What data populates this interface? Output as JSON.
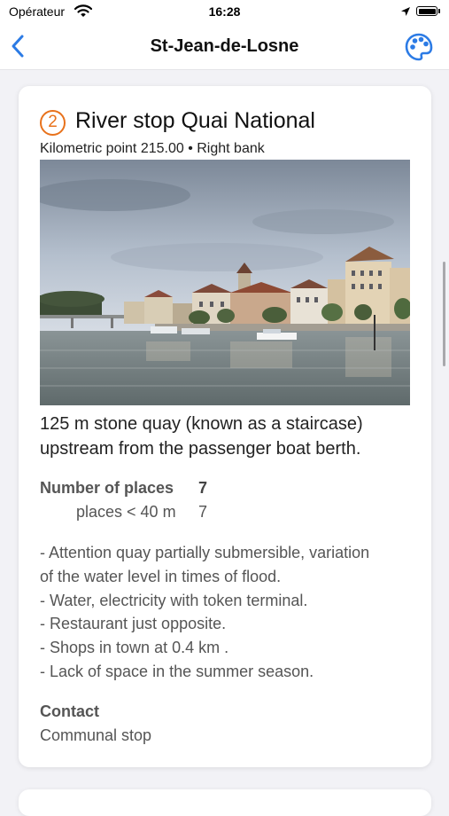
{
  "status_bar": {
    "carrier": "Opérateur",
    "time": "16:28"
  },
  "nav": {
    "title": "St-Jean-de-Losne",
    "back_icon": "chevron-left-icon",
    "palette_icon": "palette-icon",
    "accent_color": "#2c7be5"
  },
  "stop": {
    "number": "2",
    "title": "River stop Quai National",
    "subtitle": "Kilometric point 215.00 • Right bank",
    "badge_color": "#e8721c",
    "description": "125 m stone quay (known as a staircase) upstream from the passenger boat berth.",
    "places": {
      "label": "Number of places",
      "value": "7",
      "sub_label": "places < 40 m",
      "sub_value": "7"
    },
    "notes": [
      "- Attention quay partially submersible, variation",
      "of the water level in times of flood.",
      "- Water, electricity with token terminal.",
      "- Restaurant just opposite.",
      "- Shops in town at 0.4 km .",
      "- Lack of space in the summer season."
    ],
    "contact": {
      "label": "Contact",
      "value": "Communal stop"
    }
  }
}
